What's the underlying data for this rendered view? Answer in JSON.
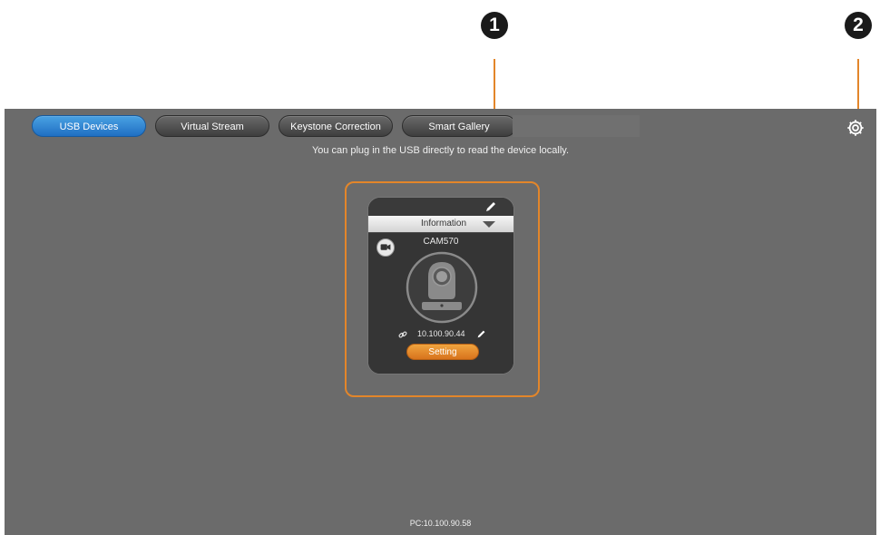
{
  "callouts": {
    "one": "1",
    "two": "2"
  },
  "tabs": [
    {
      "label": "USB Devices",
      "active": true
    },
    {
      "label": "Virtual Stream",
      "active": false
    },
    {
      "label": "Keystone Correction",
      "active": false
    },
    {
      "label": "Smart Gallery",
      "active": false
    }
  ],
  "hint": "You can plug in the USB directly to read the device locally.",
  "device_card": {
    "info_label": "Information",
    "model": "CAM570",
    "ip": "10.100.90.44",
    "setting_label": "Setting"
  },
  "footer": {
    "pc_ip": "PC:10.100.90.58"
  },
  "icons": [
    "settings-gear-icon",
    "pencil-icon",
    "chevron-down-icon",
    "camera-icon",
    "link-icon"
  ],
  "colors": {
    "accent_orange": "#e3862a",
    "active_tab_blue": "#2b86d6",
    "app_background": "#6b6b6b"
  }
}
